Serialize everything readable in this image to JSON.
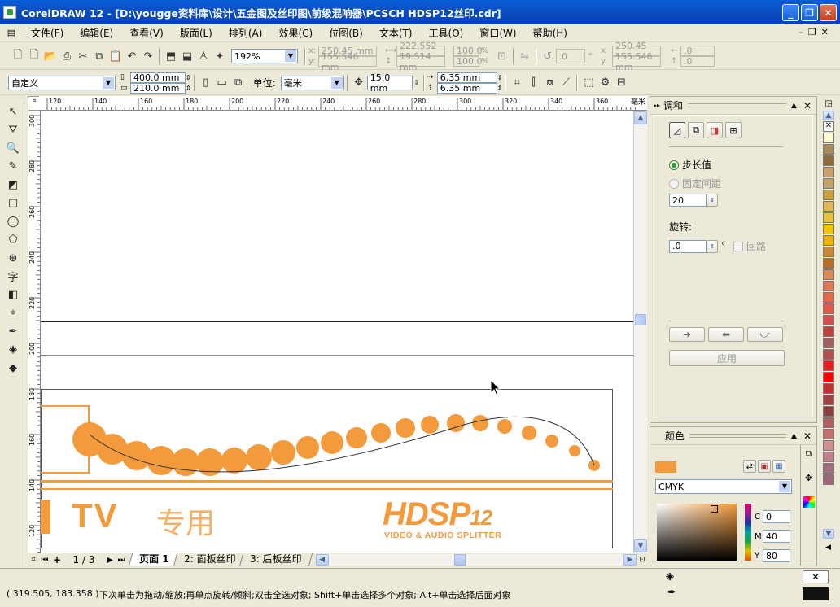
{
  "window": {
    "title": "CorelDRAW 12 - [D:\\yougge资料库\\设计\\五金图及丝印图\\前级混响器\\PCSCH HDSP12丝印.cdr]"
  },
  "menu": [
    "文件(F)",
    "编辑(E)",
    "查看(V)",
    "版面(L)",
    "排列(A)",
    "效果(C)",
    "位图(B)",
    "文本(T)",
    "工具(O)",
    "窗口(W)",
    "帮助(H)"
  ],
  "toolbar1": {
    "zoom": "192%",
    "pos_x": "250.45 mm",
    "pos_y": "155.546 mm",
    "size_w": "222.552 mm",
    "size_h": "19.514 mm",
    "scale_x": "100.0",
    "scale_y": "100.0",
    "percent": "%",
    "rotation": ".0",
    "deg": "°",
    "center_x": "250.45 mm",
    "center_y": "155.546 mm",
    "skew_x": ".0",
    "skew_y": ".0"
  },
  "toolbar2": {
    "paper": "自定义",
    "width": "400.0 mm",
    "height": "210.0 mm",
    "units_label": "单位:",
    "units": "毫米",
    "nudge": "15.0 mm",
    "dup_x": "6.35 mm",
    "dup_y": "6.35 mm"
  },
  "ruler": {
    "h_ticks": [
      "120",
      "140",
      "160",
      "180",
      "200",
      "220",
      "240",
      "260",
      "280",
      "300",
      "320",
      "340",
      "360"
    ],
    "h_unit": "毫米",
    "v_ticks": [
      "300",
      "280",
      "260",
      "240",
      "220",
      "200",
      "180",
      "160",
      "140",
      "120"
    ]
  },
  "artwork": {
    "tv_text": "TV",
    "zh_text": "专用",
    "brand": "HDSP",
    "brand_num": "12",
    "tagline": "VIDEO & AUDIO SPLITTER",
    "accent": "#f29a3c"
  },
  "pagenav": {
    "counter": "1 / 3",
    "tabs": [
      "页面 1",
      "2: 面板丝印",
      "3: 后板丝印"
    ]
  },
  "blend_docker": {
    "title": "调和",
    "opt_steps": "步长值",
    "opt_spacing": "固定间距",
    "steps": "20",
    "rotate_label": "旋转:",
    "rotate_value": ".0",
    "deg": "°",
    "loop": "回路",
    "apply": "应用"
  },
  "color_docker": {
    "title": "颜色",
    "model": "CMYK",
    "c_label": "C",
    "c": "0",
    "m_label": "M",
    "m": "40",
    "y_label": "Y",
    "y": "80"
  },
  "status": {
    "coords": "( 319.505, 183.358 )",
    "hint": "下次单击为拖动/缩放;再单点旋转/倾斜;双击全选对象; Shift+单击选择多个对象; Alt+单击选择后面对象"
  },
  "palette_colors": [
    "#ffffff",
    "#000000",
    "#fffacd",
    "#a58b5d",
    "#8c6d3e",
    "#c7a16a",
    "#bfa36a",
    "#c9a13e",
    "#e0b75a",
    "#e8c23a",
    "#f5c400",
    "#f0b000",
    "#c98a3a",
    "#b86d2a",
    "#d98a5a",
    "#e07a5a",
    "#e06a4a",
    "#e05a4a",
    "#d05050",
    "#c04040",
    "#a06060",
    "#b05050",
    "#e02020",
    "#ff0000",
    "#c03030",
    "#a04040",
    "#8a4040",
    "#b06060",
    "#c07070",
    "#d09090",
    "#c08090",
    "#a07080",
    "#9a6a7a"
  ]
}
